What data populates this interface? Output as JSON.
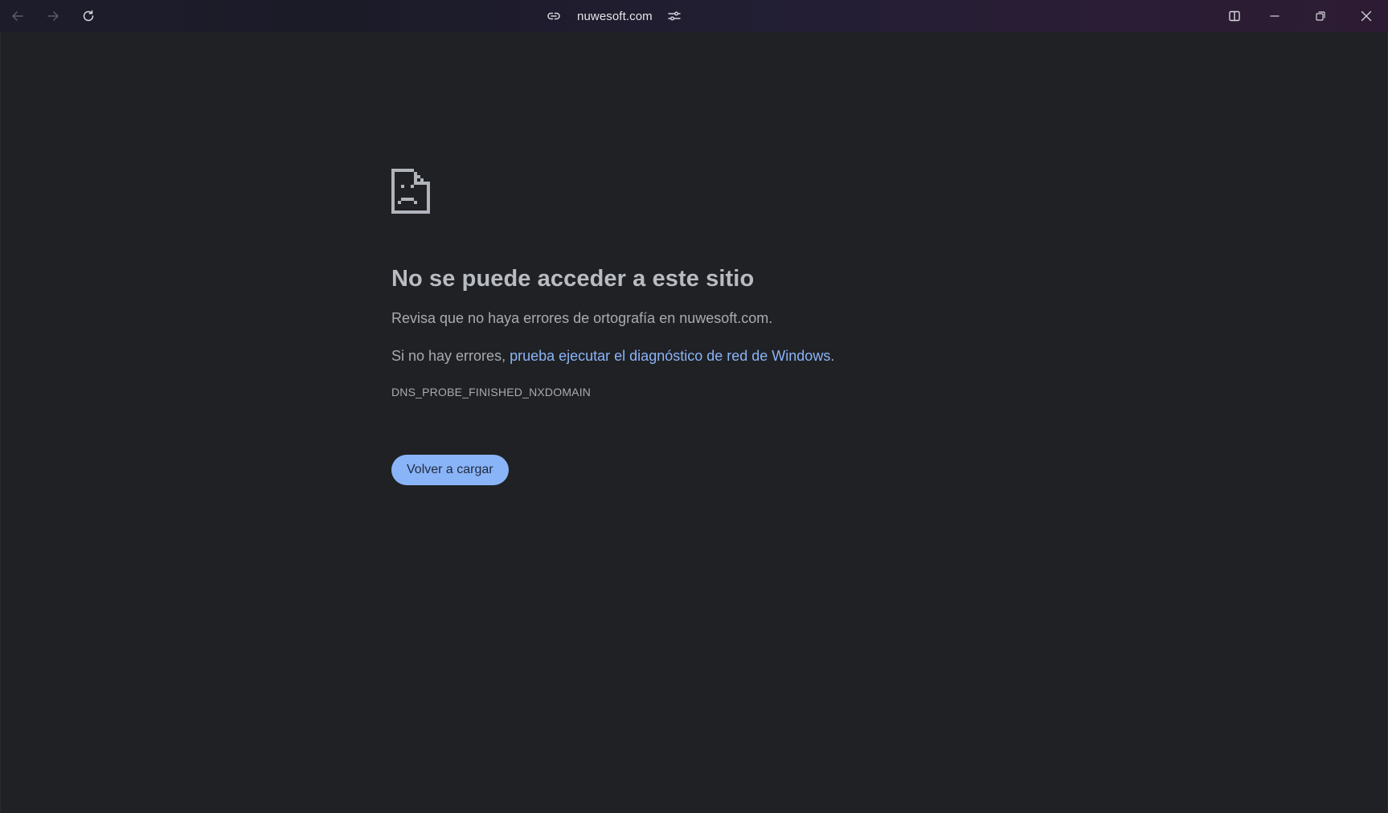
{
  "browser": {
    "address": "nuwesoft.com",
    "icons": {
      "back": "arrow-left-icon",
      "forward": "arrow-right-icon",
      "reload": "reload-icon",
      "site_info": "link-icon",
      "page_settings": "sliders-icon",
      "split_view": "split-view-icon",
      "minimize": "minimize-icon",
      "restore": "restore-icon",
      "close": "close-icon"
    }
  },
  "error_page": {
    "icon": "sad-page-icon",
    "title": "No se puede acceder a este sitio",
    "line1": "Revisa que no haya errores de ortografía en nuwesoft.com.",
    "line2_prefix": "Si no hay errores, ",
    "line2_link": "prueba ejecutar el diagnóstico de red de Windows",
    "line2_suffix": ".",
    "error_code": "DNS_PROBE_FINISHED_NXDOMAIN",
    "reload_button": "Volver a cargar"
  },
  "colors": {
    "page_background": "#202124",
    "accent": "#8ab4f8",
    "text": "#a7abb1",
    "title": "#b8bcc2"
  }
}
